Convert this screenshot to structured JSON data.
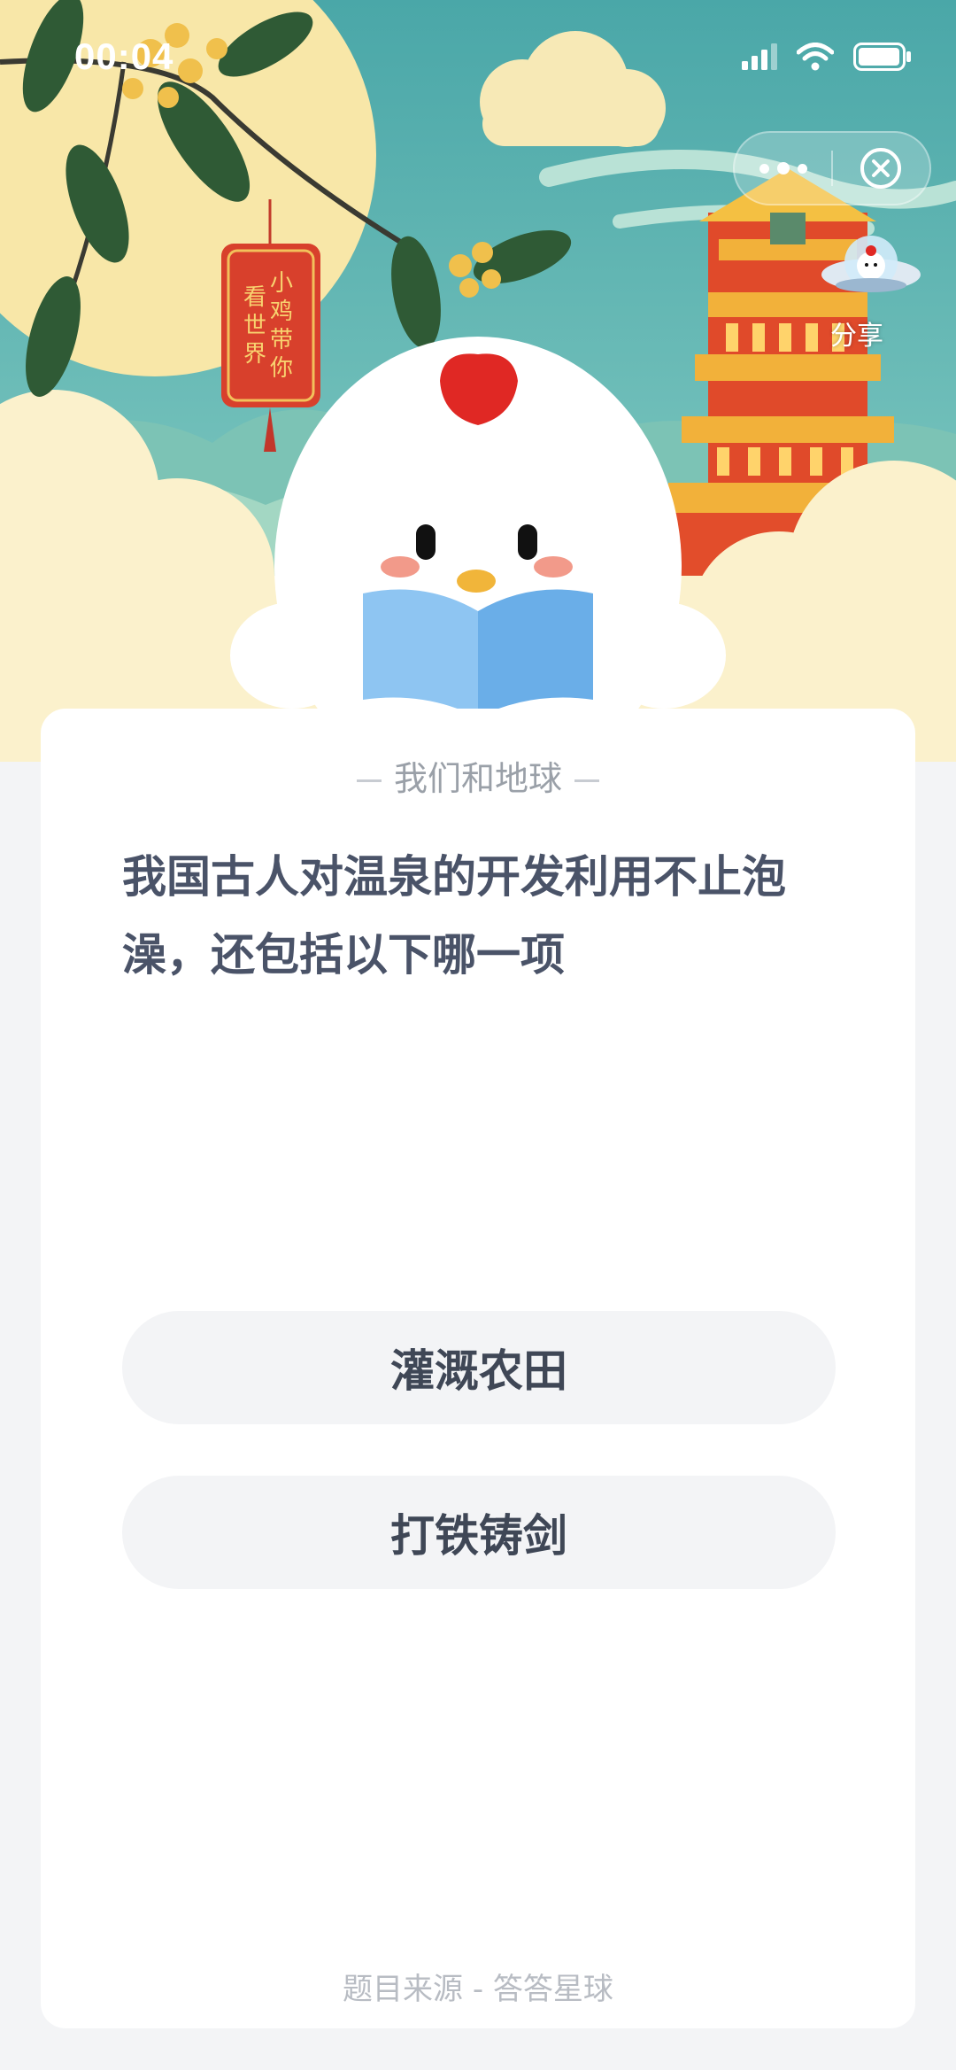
{
  "status_bar": {
    "time": "00:04",
    "icons": [
      "signal-icon",
      "wifi-icon",
      "battery-icon"
    ]
  },
  "capsule": {
    "more_icon": "more-dots-icon",
    "close_icon": "close-circle-icon"
  },
  "share": {
    "label": "分享"
  },
  "hero": {
    "tag_text": "小鸡带你看世界"
  },
  "quiz": {
    "category": "我们和地球",
    "question": "我国古人对温泉的开发利用不止泡澡，还包括以下哪一项",
    "options": [
      {
        "label": "灌溉农田"
      },
      {
        "label": "打铁铸剑"
      }
    ],
    "source": "题目来源 - 答答星球"
  },
  "colors": {
    "sky": "#5fb3b0",
    "moon": "#f8e7a8",
    "tower": "#e04a2a",
    "card_text": "#4a5368",
    "option_bg": "#f3f4f6"
  }
}
